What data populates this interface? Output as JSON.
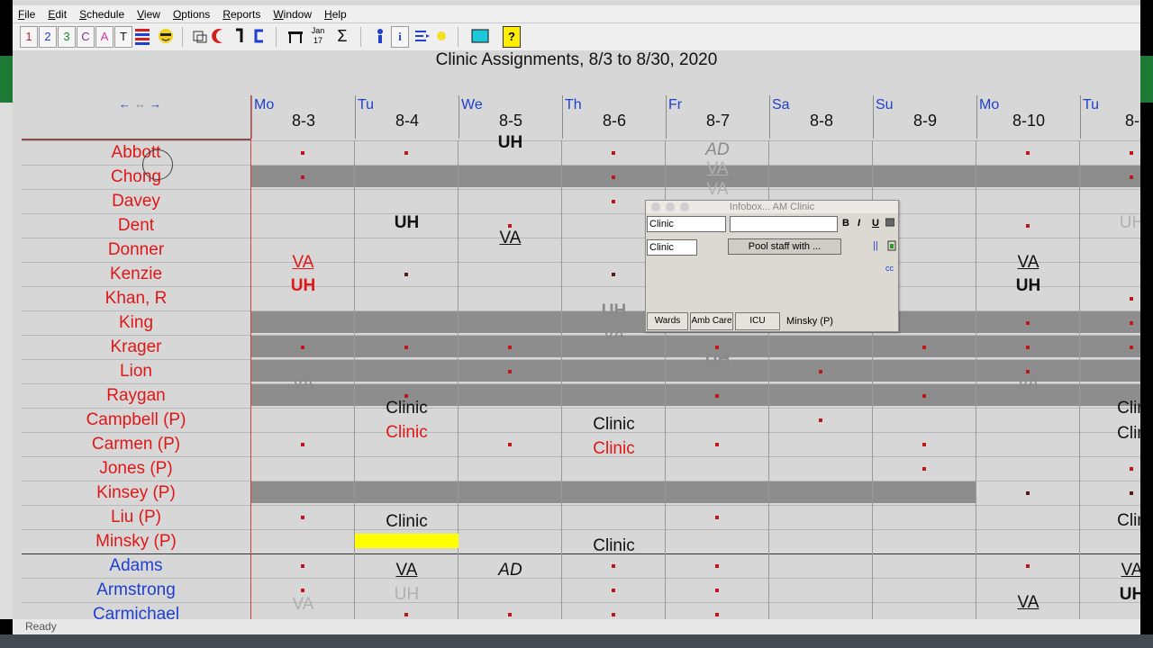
{
  "menu": [
    "File",
    "Edit",
    "Schedule",
    "View",
    "Options",
    "Reports",
    "Window",
    "Help"
  ],
  "toolbar": {
    "buttons": [
      "1",
      "2",
      "3",
      "C",
      "A",
      "T"
    ],
    "date_icon": "Jan 17",
    "help_label": "?"
  },
  "title": "Clinic Assignments, 8/3 to 8/30, 2020",
  "nav": {
    "left": "←",
    "mid": "↔",
    "right": "→"
  },
  "days": [
    {
      "abbr": "Mo",
      "date": "8-3"
    },
    {
      "abbr": "Tu",
      "date": "8-4"
    },
    {
      "abbr": "We",
      "date": "8-5"
    },
    {
      "abbr": "Th",
      "date": "8-6"
    },
    {
      "abbr": "Fr",
      "date": "8-7"
    },
    {
      "abbr": "Sa",
      "date": "8-8"
    },
    {
      "abbr": "Su",
      "date": "8-9"
    },
    {
      "abbr": "Mo",
      "date": "8-10"
    },
    {
      "abbr": "Tu",
      "date": "8-"
    }
  ],
  "staff": [
    {
      "name": "Abbott",
      "color": "red"
    },
    {
      "name": "Chong",
      "color": "red"
    },
    {
      "name": "Davey",
      "color": "red"
    },
    {
      "name": "Dent",
      "color": "red"
    },
    {
      "name": "Donner",
      "color": "red"
    },
    {
      "name": "Kenzie",
      "color": "red"
    },
    {
      "name": "Khan, R",
      "color": "red"
    },
    {
      "name": "King",
      "color": "red"
    },
    {
      "name": "Krager",
      "color": "red"
    },
    {
      "name": "Lion",
      "color": "red"
    },
    {
      "name": "Raygan",
      "color": "red"
    },
    {
      "name": "Campbell (P)",
      "color": "red"
    },
    {
      "name": "Carmen (P)",
      "color": "red"
    },
    {
      "name": "Jones (P)",
      "color": "red"
    },
    {
      "name": "Kinsey (P)",
      "color": "red"
    },
    {
      "name": "Liu (P)",
      "color": "red"
    },
    {
      "name": "Minsky (P)",
      "color": "red"
    },
    {
      "name": "Adams",
      "color": "blue"
    },
    {
      "name": "Armstrong",
      "color": "blue"
    },
    {
      "name": "Carmichael",
      "color": "blue"
    }
  ],
  "cells": {
    "uh": "UH",
    "va": "VA",
    "ad": "AD",
    "clinic": "Clinic",
    "clin": "Clin"
  },
  "infobox": {
    "title": "Infobox... AM Clinic",
    "field1": "Clinic",
    "field2": "",
    "field3": "Clinic",
    "pool_button": "Pool staff with ...",
    "fmt_b": "B",
    "fmt_i": "I",
    "fmt_u": "U",
    "tabs": [
      "Wards",
      "Amb Care",
      "ICU"
    ],
    "footer": "Minsky (P)",
    "cc": "cc"
  },
  "status": "Ready",
  "colors": {
    "red": "#e01717",
    "blue": "#1e3fd0",
    "highlight": "#ffff00",
    "shade": "#8d8d8d"
  }
}
